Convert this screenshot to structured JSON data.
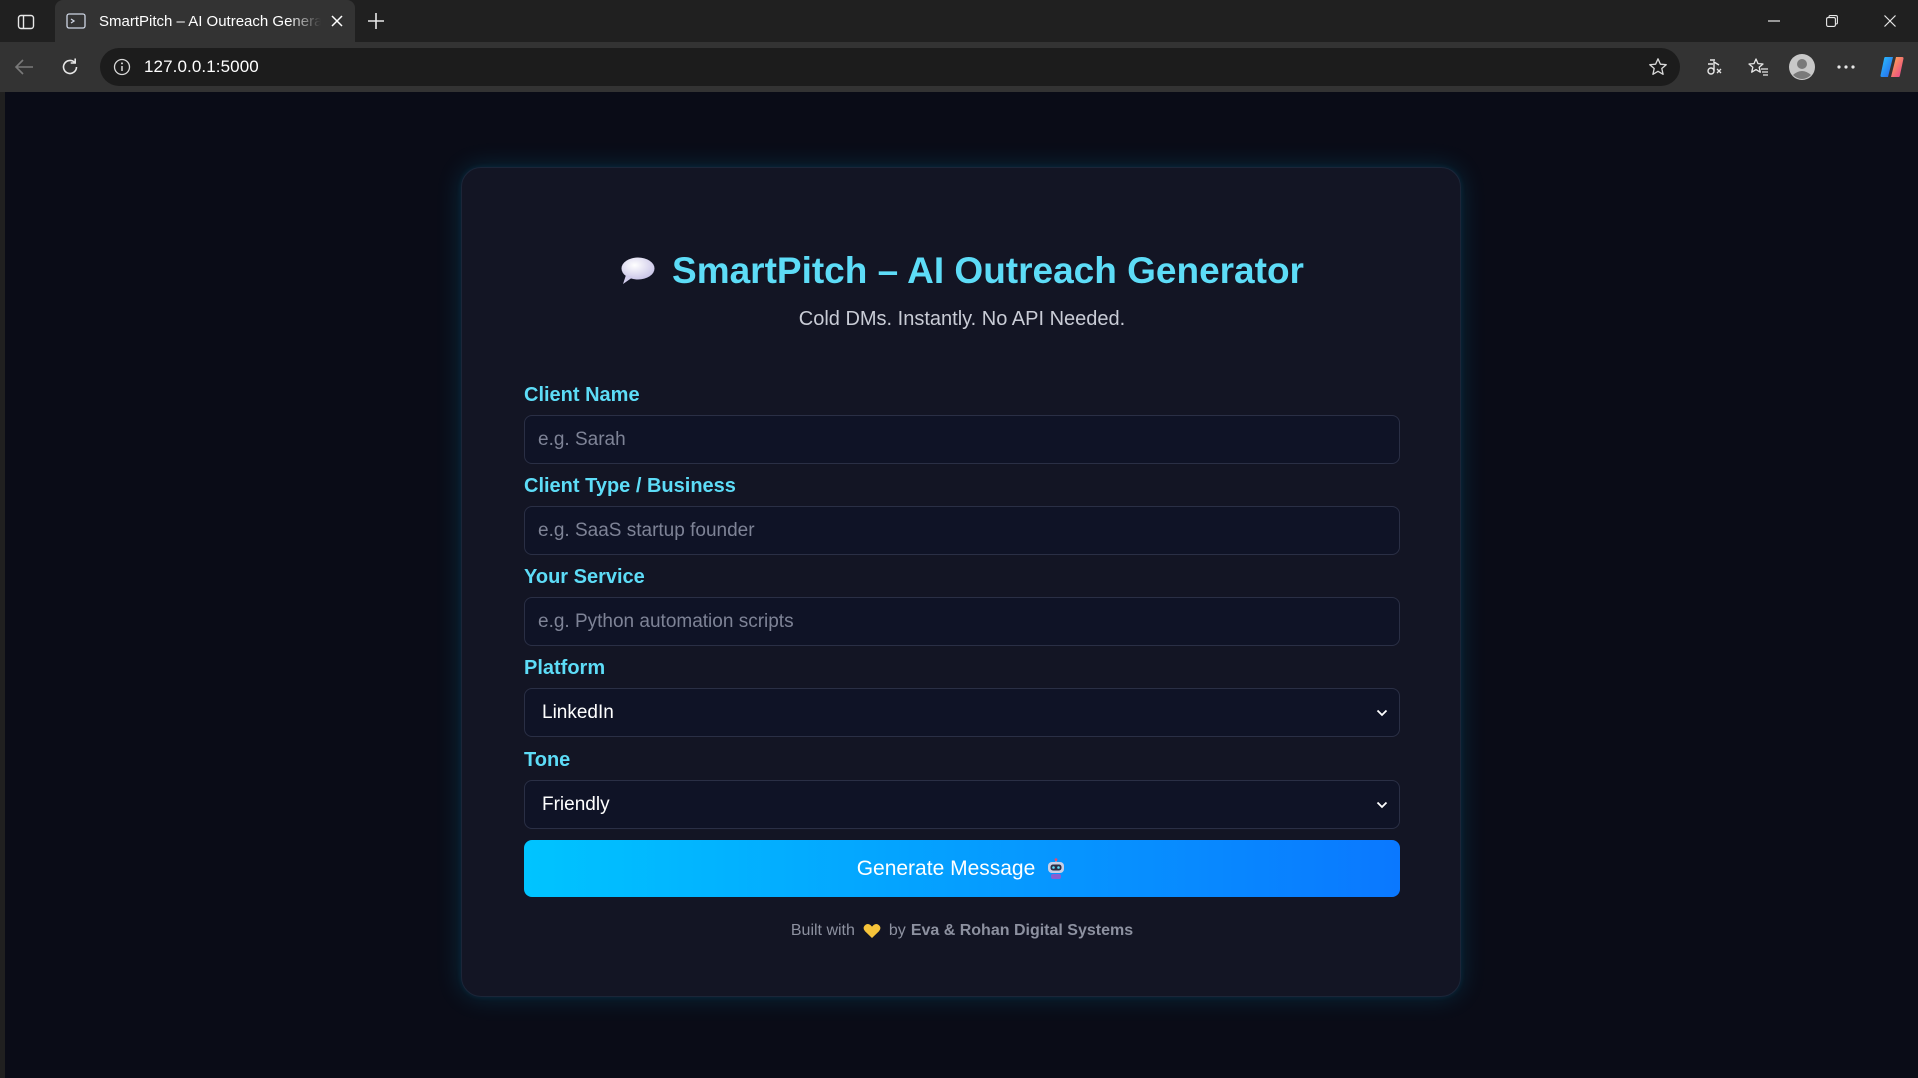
{
  "browser": {
    "tab_title": "SmartPitch – AI Outreach Generator",
    "url": "127.0.0.1:5000"
  },
  "page": {
    "title": "SmartPitch – AI Outreach Generator",
    "subtitle": "Cold DMs. Instantly. No API Needed.",
    "fields": {
      "client_name": {
        "label": "Client Name",
        "placeholder": "e.g. Sarah",
        "value": ""
      },
      "client_type": {
        "label": "Client Type / Business",
        "placeholder": "e.g. SaaS startup founder",
        "value": ""
      },
      "service": {
        "label": "Your Service",
        "placeholder": "e.g. Python automation scripts",
        "value": ""
      },
      "platform": {
        "label": "Platform",
        "selected": "LinkedIn"
      },
      "tone": {
        "label": "Tone",
        "selected": "Friendly"
      }
    },
    "generate_label": "Generate Message",
    "footer": {
      "prefix": "Built with",
      "by": "by",
      "company": "Eva & Rohan Digital Systems"
    }
  },
  "icons": {
    "heading": "speech-bubble-icon",
    "button": "robot-icon",
    "footer": "yellow-heart-icon"
  },
  "colors": {
    "accent": "#5ddcf7",
    "button_start": "#00c4ff",
    "button_end": "#0a78ff",
    "background": "#0a0c17",
    "card": "#131524"
  }
}
